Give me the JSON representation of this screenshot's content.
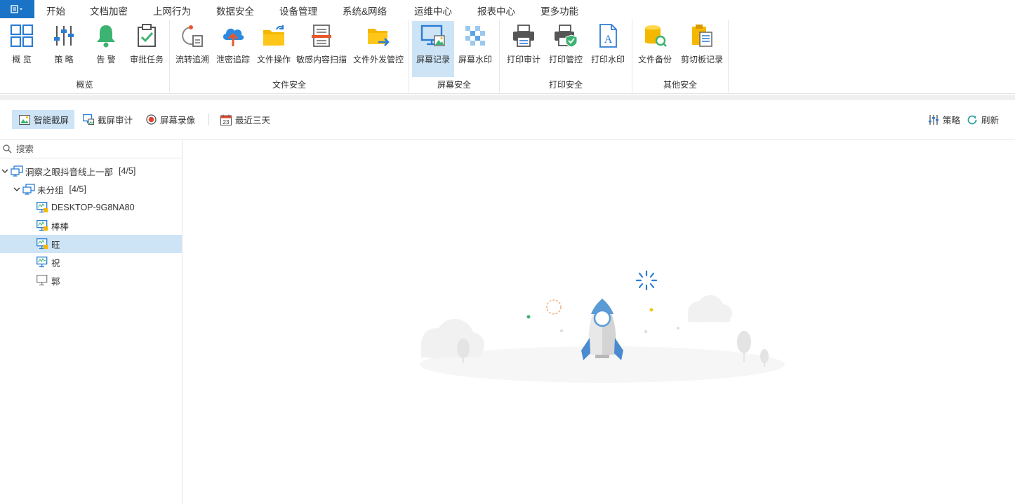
{
  "menu": {
    "items": [
      "开始",
      "文档加密",
      "上网行为",
      "数据安全",
      "设备管理",
      "系统&网络",
      "运维中心",
      "报表中心",
      "更多功能"
    ],
    "active": "数据安全"
  },
  "ribbon": {
    "groups": [
      {
        "label": "概览",
        "buttons": [
          {
            "label": "概 览",
            "icon": "overview-grid-icon"
          },
          {
            "label": "策 略",
            "icon": "policy-sliders-icon"
          },
          {
            "label": "告 警",
            "icon": "alarm-bell-icon"
          },
          {
            "label": "审批任务",
            "icon": "approval-clipboard-icon"
          }
        ]
      },
      {
        "label": "文件安全",
        "buttons": [
          {
            "label": "流转追溯",
            "icon": "flow-trace-icon"
          },
          {
            "label": "泄密追踪",
            "icon": "leak-cloud-icon"
          },
          {
            "label": "文件操作",
            "icon": "file-folder-icon"
          },
          {
            "label": "敏感内容扫描",
            "icon": "sensitive-scan-icon"
          },
          {
            "label": "文件外发管控",
            "icon": "file-send-icon"
          }
        ]
      },
      {
        "label": "屏幕安全",
        "buttons": [
          {
            "label": "屏幕记录",
            "icon": "screen-record-icon",
            "active": true
          },
          {
            "label": "屏幕水印",
            "icon": "screen-watermark-icon"
          }
        ]
      },
      {
        "label": "打印安全",
        "buttons": [
          {
            "label": "打印审计",
            "icon": "print-audit-icon"
          },
          {
            "label": "打印管控",
            "icon": "print-control-icon"
          },
          {
            "label": "打印水印",
            "icon": "print-watermark-icon"
          }
        ]
      },
      {
        "label": "其他安全",
        "buttons": [
          {
            "label": "文件备份",
            "icon": "file-backup-icon"
          },
          {
            "label": "剪切板记录",
            "icon": "clipboard-record-icon"
          }
        ]
      }
    ]
  },
  "toolbar": {
    "smart_screenshot": "智能截屏",
    "screenshot_audit": "截屏审计",
    "screen_video": "屏幕录像",
    "date_range": "最近三天",
    "calendar_day": "23",
    "policy": "策略",
    "refresh": "刷新"
  },
  "sidebar": {
    "search_placeholder": "搜索",
    "tree": [
      {
        "label": "洞察之眼抖音线上一部",
        "count": "[4/5]",
        "level": 0,
        "type": "group",
        "expanded": true
      },
      {
        "label": "未分组",
        "count": "[4/5]",
        "level": 1,
        "type": "group",
        "expanded": true
      },
      {
        "label": "DESKTOP-9G8NA80",
        "level": 2,
        "type": "pc-locked"
      },
      {
        "label": "棒棒",
        "level": 2,
        "type": "pc-locked"
      },
      {
        "label": "旺",
        "level": 2,
        "type": "pc-locked",
        "selected": true
      },
      {
        "label": "祝",
        "level": 2,
        "type": "pc-online"
      },
      {
        "label": "郭",
        "level": 2,
        "type": "pc-offline"
      }
    ]
  },
  "colors": {
    "accent": "#2b7cd3",
    "selected_bg": "#cde4f7",
    "app_button": "#1a73c6"
  }
}
